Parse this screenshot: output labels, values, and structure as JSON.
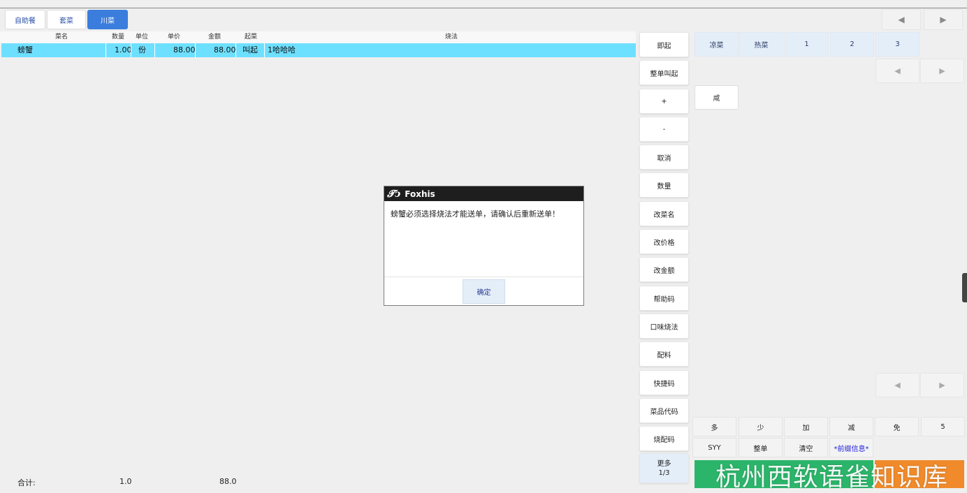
{
  "tabs": [
    "自助餐",
    "套菜",
    "川菜"
  ],
  "active_tab": "川菜",
  "table": {
    "headers": [
      "菜名",
      "数量",
      "单位",
      "单价",
      "金额",
      "起菜",
      "烧法"
    ],
    "rows": [
      {
        "name": "螃蟹",
        "qty": "1.00",
        "unit": "份",
        "price": "88.00",
        "amount": "88.00",
        "start": "叫起",
        "method": "1哈哈哈"
      }
    ],
    "footer": {
      "label": "合计:",
      "qty": "1.0",
      "amount": "88.0"
    }
  },
  "function_buttons": [
    "即起",
    "整单叫起",
    "+",
    "-",
    "取消",
    "数量",
    "改菜名",
    "改价格",
    "改金额",
    "帮助码",
    "口味烧法",
    "配料",
    "快捷码",
    "菜品代码",
    "烧配码"
  ],
  "more_button": {
    "label": "更多",
    "page": "1/3"
  },
  "categories": [
    "凉菜",
    "热菜",
    "1",
    "2",
    "3"
  ],
  "items": [
    "咸"
  ],
  "taste_row1": [
    "多",
    "少",
    "加",
    "减",
    "免",
    "5"
  ],
  "taste_row2": [
    "SYY",
    "整单",
    "清空",
    "*前缀信息*"
  ],
  "nav": {
    "prev": "◀",
    "next": "▶"
  },
  "dialog": {
    "title": "Foxhis",
    "logo": "𝓣ↄ",
    "message": "螃蟹必须选择烧法才能送单，请确认后重新送单！",
    "ok_label": "确定"
  },
  "watermark": "杭州西软语雀知识库",
  "colors": {
    "selected_row": "#6ee0ff",
    "active_tab": "#3b7ddd",
    "green_button": "#2bb56a",
    "orange_button": "#f08a2a",
    "prefix_text": "#2222dd"
  }
}
